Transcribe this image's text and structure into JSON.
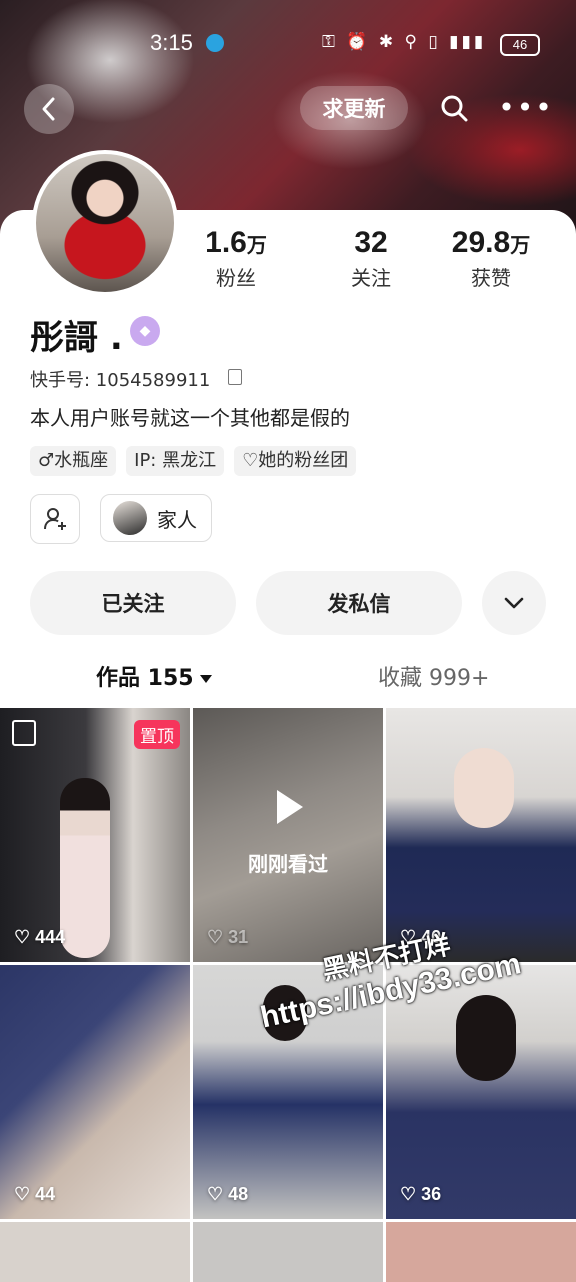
{
  "status_bar": {
    "time": "3:15",
    "battery": "46"
  },
  "header": {
    "update_button": "求更新"
  },
  "profile": {
    "name": "彤謌 .",
    "kuaishou_id_label": "快手号: ",
    "kuaishou_id": "1054589911",
    "bio": "本人用户账号就这一个其他都是假的",
    "stats": [
      {
        "value": "1.6",
        "unit": "万",
        "label": "粉丝"
      },
      {
        "value": "32",
        "unit": "",
        "label": "关注"
      },
      {
        "value": "29.8",
        "unit": "万",
        "label": "获赞"
      }
    ],
    "tags": [
      "水瓶座",
      "IP: 黑龙江",
      "她的粉丝团"
    ],
    "family_label": "家人"
  },
  "actions": {
    "follow": "已关注",
    "message": "发私信"
  },
  "tabs": {
    "works": "作品 155",
    "favorites": "收藏 999+"
  },
  "grid": {
    "pinned_label": "置顶",
    "seen_label": "刚刚看过",
    "items": [
      {
        "likes": "444"
      },
      {
        "likes": "31"
      },
      {
        "likes": "40"
      },
      {
        "likes": "44"
      },
      {
        "likes": "48"
      },
      {
        "likes": "36"
      }
    ]
  },
  "watermark": {
    "line1": "黑料不打烊",
    "line2": "https://ibdy33.com"
  },
  "colors": {
    "pin_badge": "#f6355c",
    "accent_badge": "#c9a9ef"
  }
}
